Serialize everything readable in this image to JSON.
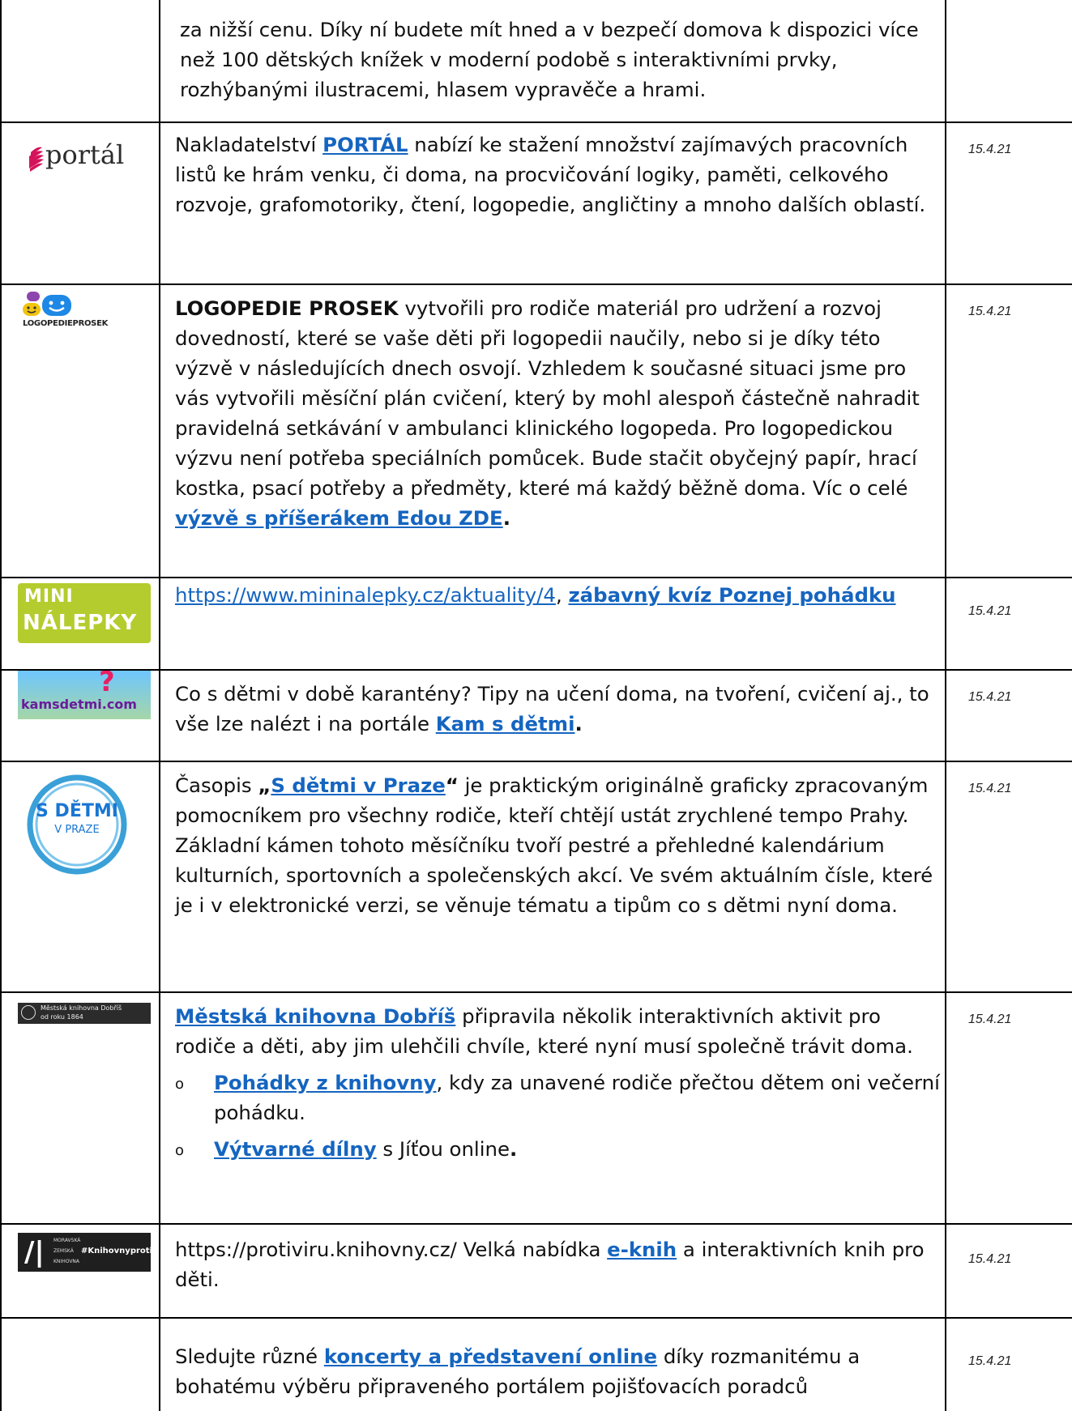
{
  "rows": [
    {
      "id": "r0",
      "text": "za nižší cenu. Díky ní budete mít hned a v bezpečí domova k dispozici více než 100 dětských knížek v moderní podobě s interaktivními prvky, rozhýbanými ilustracemi, hlasem vypravěče a hrami.",
      "date": ""
    },
    {
      "id": "portal",
      "logo_text": "portál",
      "pre": "Nakladatelství ",
      "link": "PORTÁL",
      "post": " nabízí ke stažení množství zajímavých pracovních listů ke hrám venku, či doma, na procvičování logiky, paměti, celkového rozvoje, grafomotoriky, čtení, logopedie, angličtiny a mnoho dalších oblastí.",
      "date": "15.4.21"
    },
    {
      "id": "prosek",
      "logo_text": "LOGOPEDIEPROSEK",
      "bold": "LOGOPEDIE PROSEK",
      "body": " vytvořili pro rodiče materiál pro udržení a rozvoj dovedností, které se vaše děti při logopedii naučily, nebo si je díky této výzvě v následujících dnech osvojí. Vzhledem k současné situaci jsme pro vás vytvořili měsíční plán cvičení, který by mohl alespoň částečně nahradit pravidelná setkávání v ambulanci klinického logopeda. Pro logopedickou výzvu není potřeba speciálních pomůcek. Bude stačit obyčejný papír, hrací kostka, psací potřeby a předměty, které má každý běžně doma. Víc o celé ",
      "link": "výzvě s příšerákem Edou ZDE",
      "end": ".",
      "date": "15.4.21"
    },
    {
      "id": "mini",
      "logo_line1": "MINI",
      "logo_line2": "NÁLEPKY",
      "url": "https://www.mininalepky.cz/aktuality/4",
      "sep": ", ",
      "link": "zábavný kvíz Poznej pohádku",
      "date": "15.4.21"
    },
    {
      "id": "kam",
      "logo_text": "kamsdetmi.com",
      "body": "Co s dětmi v době karantény? Tipy na učení doma, na tvoření, cvičení aj., to vše lze nalézt i na portále ",
      "link": "Kam s dětmi",
      "end": ".",
      "date": "15.4.21"
    },
    {
      "id": "sdetmi",
      "logo_line1": "S DĚTMI",
      "logo_line2": "V PRAZE",
      "pre": "Časopis ",
      "q_open": "„",
      "link": "S dětmi v Praze",
      "q_close": "“",
      "body": " je praktickým originálně graficky zpracovaným pomocníkem pro všechny rodiče, kteří chtějí ustát zrychlené tempo Prahy. Základní kámen tohoto měsíčníku tvoří pestré a přehledné kalendárium kulturních, sportovních a společenských akcí. Ve svém aktuálním čísle, které je i v elektronické verzi, se věnuje tématu a tipům co s dětmi nyní doma.",
      "date": "15.4.21"
    },
    {
      "id": "dobris",
      "logo_line1": "Městská knihovna Dobříš",
      "logo_line2": "od roku 1864",
      "link": "Městská knihovna Dobříš",
      "body": " připravila několik interaktivních aktivit pro rodiče a děti, aby jim ulehčili chvíle, které nyní musí společně trávit doma.",
      "bullets": [
        {
          "link": "Pohádky z knihovny",
          "text": ", kdy za unavené rodiče přečtou dětem oni večerní pohádku."
        },
        {
          "link": "Výtvarné dílny",
          "text": " s Jíťou online",
          "end": "."
        }
      ],
      "bullet_symbol": "o",
      "date": "15.4.21"
    },
    {
      "id": "mzk",
      "logo_text1": "MORAVSKÁ",
      "logo_text2": "ZEMSKÁ",
      "logo_text3": "KNIHOVNA",
      "logo_tag": "#Knihovnyprotiviru",
      "pre": "https://protiviru.knihovny.cz/  Velká nabídka ",
      "link": "e-knih",
      "post": " a interaktivních knih pro děti.",
      "date": "15.4.21"
    },
    {
      "id": "koncerty",
      "pre": "Sledujte různé ",
      "link": "koncerty a představení online",
      "post": " díky rozmanitému a bohatému výběru připraveného portálem pojišťovacích poradců",
      "date": "15.4.21"
    }
  ],
  "colors": {
    "link": "#1565c0",
    "border": "#000000",
    "mini_bg": "#b5cc2e",
    "sdetmi_ring": "#3aa0d8"
  }
}
